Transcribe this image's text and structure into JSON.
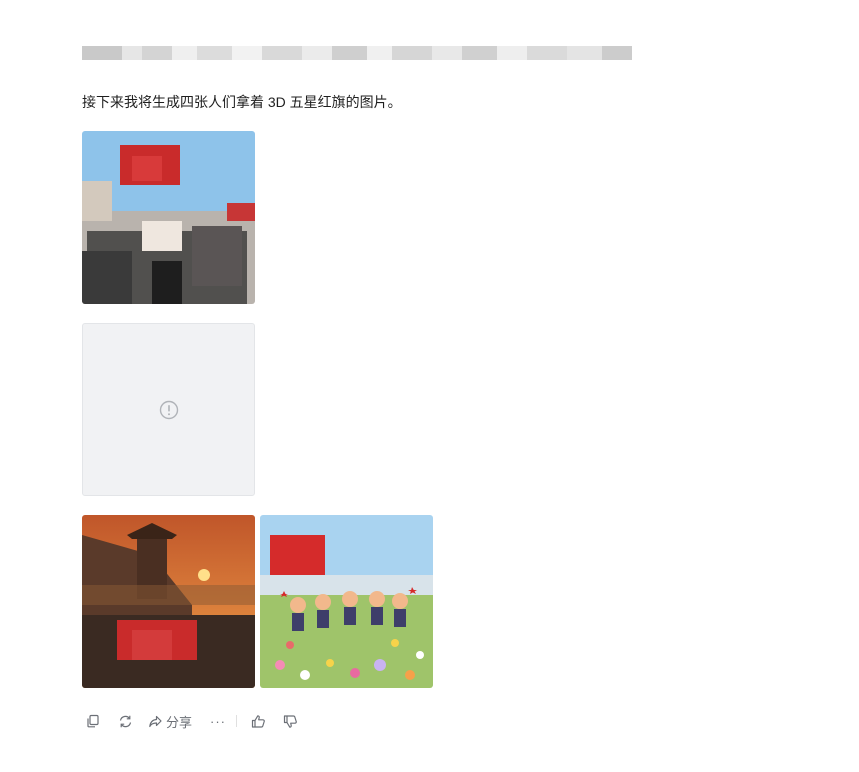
{
  "message": {
    "intro_text": "接下来我将生成四张人们拿着 3D 五星红旗的图片。"
  },
  "images": [
    {
      "description": "generated-image-1"
    },
    {
      "status": "failed"
    },
    {
      "description": "generated-image-3"
    },
    {
      "description": "generated-image-4"
    }
  ],
  "toolbar": {
    "copy_icon": "copy-icon",
    "regenerate_icon": "refresh-icon",
    "share_label": "分享",
    "more_label": "···",
    "like_icon": "thumbs-up-icon",
    "dislike_icon": "thumbs-down-icon"
  },
  "colors": {
    "icon_gray": "#6b6f76",
    "placeholder_bg": "#f1f2f4",
    "flag_red": "#d62a2a"
  }
}
